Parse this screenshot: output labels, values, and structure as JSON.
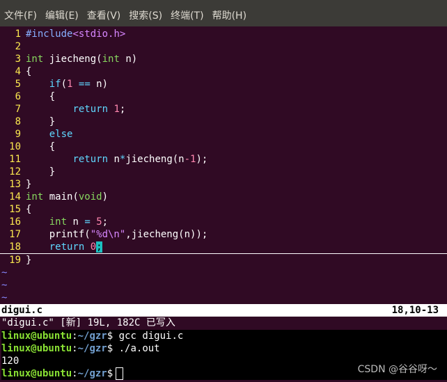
{
  "menubar": {
    "items": [
      "文件(F)",
      "编辑(E)",
      "查看(V)",
      "搜索(S)",
      "终端(T)",
      "帮助(H)"
    ]
  },
  "editor": {
    "lines": [
      {
        "n": "1",
        "tokens": [
          {
            "t": "#include",
            "c": "pre"
          },
          {
            "t": "<stdio.h>",
            "c": "str"
          }
        ]
      },
      {
        "n": "2",
        "tokens": []
      },
      {
        "n": "3",
        "tokens": [
          {
            "t": "int",
            "c": "type"
          },
          {
            "t": " jiecheng(",
            "c": ""
          },
          {
            "t": "int",
            "c": "type"
          },
          {
            "t": " n)",
            "c": ""
          }
        ]
      },
      {
        "n": "4",
        "tokens": [
          {
            "t": "{",
            "c": ""
          }
        ]
      },
      {
        "n": "5",
        "tokens": [
          {
            "t": "    ",
            "c": ""
          },
          {
            "t": "if",
            "c": "kw"
          },
          {
            "t": "(",
            "c": ""
          },
          {
            "t": "1",
            "c": "num"
          },
          {
            "t": " ",
            "c": ""
          },
          {
            "t": "==",
            "c": "kw"
          },
          {
            "t": " n)",
            "c": ""
          }
        ]
      },
      {
        "n": "6",
        "tokens": [
          {
            "t": "    {",
            "c": ""
          }
        ]
      },
      {
        "n": "7",
        "tokens": [
          {
            "t": "        ",
            "c": ""
          },
          {
            "t": "return",
            "c": "kw"
          },
          {
            "t": " ",
            "c": ""
          },
          {
            "t": "1",
            "c": "num"
          },
          {
            "t": ";",
            "c": ""
          }
        ]
      },
      {
        "n": "8",
        "tokens": [
          {
            "t": "    }",
            "c": ""
          }
        ]
      },
      {
        "n": "9",
        "tokens": [
          {
            "t": "    ",
            "c": ""
          },
          {
            "t": "else",
            "c": "kw"
          }
        ]
      },
      {
        "n": "10",
        "tokens": [
          {
            "t": "    {",
            "c": ""
          }
        ]
      },
      {
        "n": "11",
        "tokens": [
          {
            "t": "        ",
            "c": ""
          },
          {
            "t": "return",
            "c": "kw"
          },
          {
            "t": " n",
            "c": ""
          },
          {
            "t": "*",
            "c": "kw"
          },
          {
            "t": "jiecheng(n",
            "c": ""
          },
          {
            "t": "-1",
            "c": "num"
          },
          {
            "t": ");",
            "c": ""
          }
        ]
      },
      {
        "n": "12",
        "tokens": [
          {
            "t": "    }",
            "c": ""
          }
        ]
      },
      {
        "n": "13",
        "tokens": [
          {
            "t": "}",
            "c": ""
          }
        ]
      },
      {
        "n": "14",
        "tokens": [
          {
            "t": "int",
            "c": "type"
          },
          {
            "t": " main(",
            "c": ""
          },
          {
            "t": "void",
            "c": "type"
          },
          {
            "t": ")",
            "c": ""
          }
        ]
      },
      {
        "n": "15",
        "tokens": [
          {
            "t": "{",
            "c": ""
          }
        ]
      },
      {
        "n": "16",
        "tokens": [
          {
            "t": "    ",
            "c": ""
          },
          {
            "t": "int",
            "c": "type"
          },
          {
            "t": " n ",
            "c": ""
          },
          {
            "t": "=",
            "c": "kw"
          },
          {
            "t": " ",
            "c": ""
          },
          {
            "t": "5",
            "c": "num"
          },
          {
            "t": ";",
            "c": ""
          }
        ]
      },
      {
        "n": "17",
        "tokens": [
          {
            "t": "    printf(",
            "c": ""
          },
          {
            "t": "\"%d\\n\"",
            "c": "str"
          },
          {
            "t": ",jiecheng(n));",
            "c": ""
          }
        ]
      },
      {
        "n": "18",
        "cursorline": true,
        "tokens": [
          {
            "t": "    ",
            "c": ""
          },
          {
            "t": "return",
            "c": "kw"
          },
          {
            "t": " ",
            "c": ""
          },
          {
            "t": "0",
            "c": "num"
          },
          {
            "t": ";",
            "c": "cursor"
          }
        ]
      },
      {
        "n": "19",
        "tokens": [
          {
            "t": "}",
            "c": ""
          }
        ]
      }
    ],
    "tildes": [
      "~",
      "~",
      "~"
    ]
  },
  "status": {
    "file": "digui.c",
    "position": "18,10-13"
  },
  "cmdline": "\"digui.c\" [新] 19L, 182C 已写入",
  "terminal": {
    "user": "linux@ubuntu",
    "path": "~/gzr",
    "lines": [
      {
        "prompt": true,
        "cmd": " gcc digui.c"
      },
      {
        "prompt": true,
        "cmd": " ./a.out"
      },
      {
        "prompt": false,
        "text": "120"
      },
      {
        "prompt": true,
        "cmd": "",
        "cursor": true
      }
    ]
  },
  "watermark": "CSDN @谷谷呀～",
  "colors": {
    "background": "#300a24",
    "linenumber": "#fce94f",
    "cursor": "#1cc0c0"
  }
}
